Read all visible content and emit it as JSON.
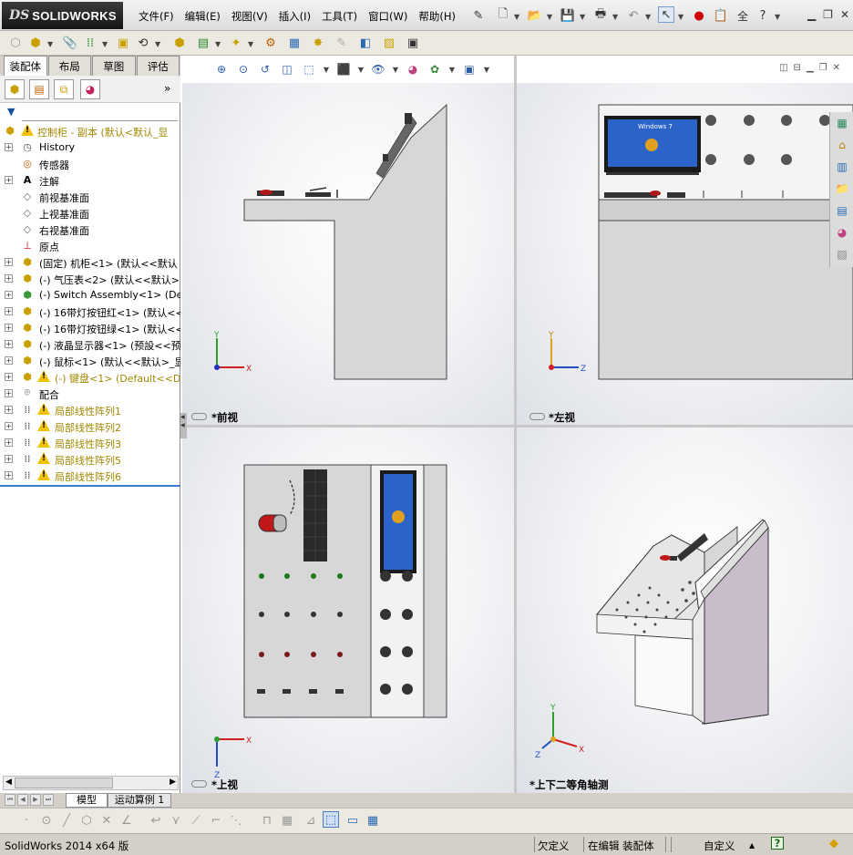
{
  "app": {
    "logo_ds": "DS",
    "logo_name": "SOLIDWORKS"
  },
  "menu": [
    "文件(F)",
    "编辑(E)",
    "视图(V)",
    "插入(I)",
    "工具(T)",
    "窗口(W)",
    "帮助(H)"
  ],
  "title_toolbar": {
    "search_abbrev": "全"
  },
  "left_tabs": [
    "装配体",
    "布局",
    "草图",
    "评估"
  ],
  "tree": {
    "root": "控制柜 - 副本  (默认<默认_显",
    "items": [
      {
        "label": "History",
        "kind": "history"
      },
      {
        "label": "传感器",
        "kind": "sensor"
      },
      {
        "label": "注解",
        "kind": "annotation"
      },
      {
        "label": "前视基准面",
        "kind": "plane"
      },
      {
        "label": "上视基准面",
        "kind": "plane"
      },
      {
        "label": "右视基准面",
        "kind": "plane"
      },
      {
        "label": "原点",
        "kind": "origin"
      },
      {
        "label": "(固定) 机柜<1> (默认<<默认",
        "kind": "part"
      },
      {
        "label": "(-) 气压表<2> (默认<<默认>",
        "kind": "part"
      },
      {
        "label": "(-) Switch Assembly<1> (Defau",
        "kind": "assembly"
      },
      {
        "label": "(-) 16带灯按钮红<1> (默认<<",
        "kind": "part"
      },
      {
        "label": "(-) 16带灯按钮绿<1> (默认<<",
        "kind": "part"
      },
      {
        "label": "(-) 液晶显示器<1> (预設<<预",
        "kind": "part"
      },
      {
        "label": "(-) 鼠标<1> (默认<<默认>_显",
        "kind": "part"
      },
      {
        "label": "(-) 键盘<1> (Default<<Def",
        "kind": "part-warn"
      },
      {
        "label": "配合",
        "kind": "mates"
      },
      {
        "label": "局部线性阵列1",
        "kind": "pattern"
      },
      {
        "label": "局部线性阵列2",
        "kind": "pattern"
      },
      {
        "label": "局部线性阵列3",
        "kind": "pattern"
      },
      {
        "label": "局部线性阵列5",
        "kind": "pattern"
      },
      {
        "label": "局部线性阵列6",
        "kind": "pattern"
      }
    ]
  },
  "bottom_tabs": [
    "模型",
    "运动算例 1"
  ],
  "viewports": {
    "front": "*前视",
    "left": "*左视",
    "top": "*上视",
    "iso": "*上下二等角轴测"
  },
  "axes": {
    "x": "X",
    "y": "Y",
    "z": "Z"
  },
  "monitor_text": "Windows 7",
  "status": {
    "app": "SolidWorks 2014 x64 版",
    "definition": "欠定义",
    "editing": "在编辑 装配体",
    "units": "自定义",
    "help": "?"
  },
  "colors": {
    "cabinet": "#d7d7d7",
    "cabinet_iso_side": "#c9bccb",
    "highlight_blue": "#1f4fbf",
    "warning_yellow": "#f2c200"
  }
}
